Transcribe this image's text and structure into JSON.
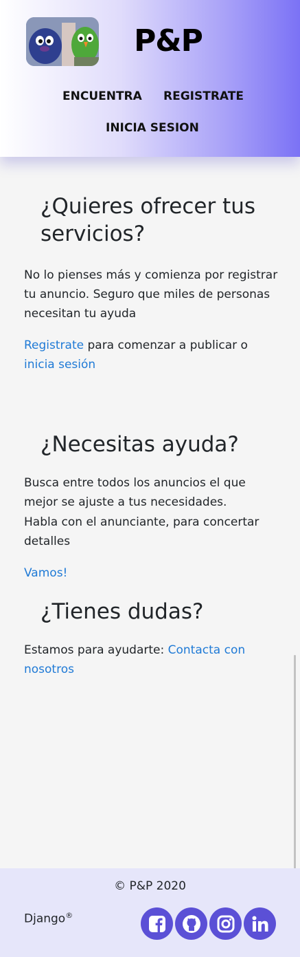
{
  "header": {
    "logo_alt": "P&P logo",
    "brand": "P&P",
    "nav": {
      "encuentra": "ENCUENTRA",
      "registrate": "REGISTRATE",
      "inicia_sesion": "INICIA SESION"
    }
  },
  "offer": {
    "title": "¿Quieres ofrecer tus servicios?",
    "body": "No lo pienses más y comienza por registrar tu anuncio. Seguro que miles de personas necesitan tu ayuda",
    "register_link": "Registrate",
    "middle_text": " para comenzar a publicar o ",
    "login_link": "inicia sesión"
  },
  "help": {
    "title": "¿Necesitas ayuda?",
    "line1": "Busca entre todos los anuncios el que mejor se ajuste a tus necesidades.",
    "line2": "Habla con el anunciante, para concertar detalles",
    "link": "Vamos!"
  },
  "doubts": {
    "title": "¿Tienes dudas?",
    "text": "Estamos para ayudarte: ",
    "link": "Contacta con nosotros"
  },
  "footer": {
    "copyright": "© P&P 2020",
    "django": "Django",
    "django_mark": "®",
    "social_color": "#5b50d6",
    "social_icons": [
      "facebook-icon",
      "github-icon",
      "instagram-icon",
      "linkedin-icon"
    ]
  },
  "colors": {
    "link": "#1f7ad6",
    "header_gradient_end": "#7b72f5",
    "footer_bg": "#e6e6fa"
  }
}
